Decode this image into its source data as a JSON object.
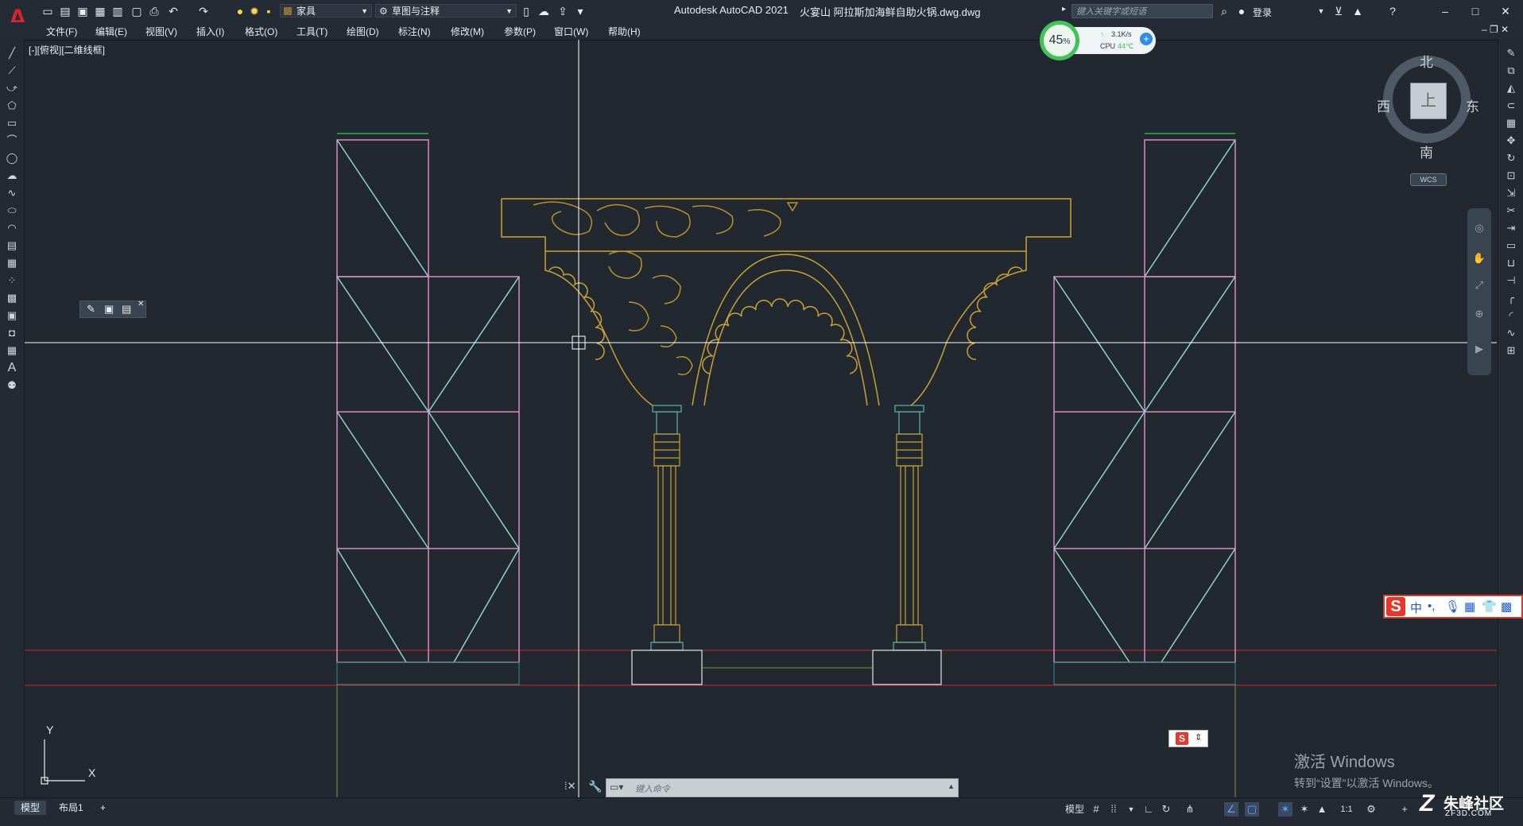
{
  "app": {
    "title": "Autodesk AutoCAD 2021",
    "filename": "火宴山 阿拉斯加海鲜自助火锅.dwg.dwg",
    "logo": "A",
    "search_placeholder": "键入关键字或短语",
    "login": "登录"
  },
  "quick_access": {
    "layer_dropdown": "家具",
    "workspace_dropdown": "草图与注释"
  },
  "menu": [
    "文件(F)",
    "编辑(E)",
    "视图(V)",
    "插入(I)",
    "格式(O)",
    "工具(T)",
    "绘图(D)",
    "标注(N)",
    "修改(M)",
    "参数(P)",
    "窗口(W)",
    "帮助(H)"
  ],
  "viewport_label": "[-][俯视][二维线框]",
  "net_monitor": {
    "percent": "45",
    "percent_unit": "%",
    "speed": "3.1K/s",
    "cpu_label": "CPU",
    "cpu_temp": "44℃"
  },
  "viewcube": {
    "north": "北",
    "south": "南",
    "east": "东",
    "west": "西",
    "top": "上",
    "wcs": "WCS"
  },
  "ucs": {
    "x": "X",
    "y": "Y"
  },
  "command_line": {
    "placeholder": "键入命令"
  },
  "layout_tabs": [
    "模型",
    "布局1",
    "+"
  ],
  "status": {
    "model": "模型",
    "scale": "1:1"
  },
  "activation": {
    "line1": "激活 Windows",
    "line2": "转到“设置”以激活 Windows。"
  },
  "watermark": {
    "text": "朱峰社区",
    "url": "ZF3D.COM"
  },
  "ime": {
    "lang": "中"
  },
  "colors": {
    "frame_pink": "#d98bbd",
    "frame_brace": "#8fd3cf",
    "arch_gold": "#c9a233",
    "column_green": "#5fb3a8",
    "red_line": "#d32424",
    "crosshair": "#ffffff",
    "top_green": "#2eaf4b"
  }
}
